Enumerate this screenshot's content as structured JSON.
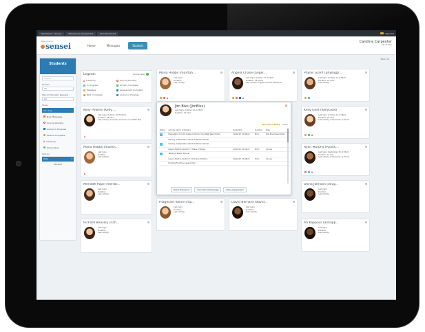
{
  "top_tabs": [
    "Dashboard - Sensei",
    "Attendance Assessment",
    "Plan Document"
  ],
  "top_right": "Sign Out",
  "logo": {
    "small": "Welcome to",
    "main": "sensei"
  },
  "nav": [
    "Home",
    "Messages",
    "Student"
  ],
  "user": {
    "name": "Caroline Carpenter",
    "profile": "My Profile"
  },
  "sidebar": {
    "title": "Students",
    "search_placeholder": "Search",
    "group_label": "Groups",
    "group_value": "All",
    "plan_label": "Plan to Manually Request",
    "plan_value": "All",
    "show_label": "Show",
    "filters": [
      "All / Any",
      "New Messages",
      "Scoring Pending",
      "Locked in Progress",
      "Module Complete",
      "Inactivity",
      "Online Now"
    ],
    "sort_label": "Sort by",
    "sort_value": "Date",
    "sort_option": "Student"
  },
  "total_label": "Total: 20",
  "legend": {
    "title": "Legend:",
    "online_now": "Online Now",
    "items": [
      "Inactivity",
      "Scoring Pending",
      "In Progress",
      "Activity Complete",
      "Message",
      "Assessment Complete",
      "Mod. Complete",
      "Locked in Progress"
    ]
  },
  "students": [
    {
      "name": "Maria Hobbs (maritah...",
      "login": "Last login:",
      "duration": "Duration:",
      "activity": "Last activity:"
    },
    {
      "name": "Angela Chase (angel...",
      "login": "Last login: October 17, 2:35am",
      "duration": "Duration: 14.5mins",
      "activity": "Last activity: Angles and their Measures"
    },
    {
      "name": "Phyllis Grant (phylliggr...",
      "login": "Last login: October 14, 8:46am",
      "duration": "Duration: 16 mins",
      "activity": "Last activity:"
    },
    {
      "name": "Kelly Powers (Kelly ...",
      "login": "Last login: October 13, 8:50 pm",
      "duration": "Duration: 16 mins",
      "activity": "Last activity: Geometry Common Core Math Plan"
    },
    {
      "name": "Kelly Gold (KellyGold)",
      "login": "Last login: October 14, 2:34pm",
      "duration": "Duration: 18 mins",
      "activity": "Last activity: Introduction to Forms"
    },
    {
      "name": "Maria Hobbs (marish...",
      "login": "Last login:",
      "duration": "Duration:",
      "activity": "Last activity:"
    },
    {
      "name": "Ryan Murphy (RyanC...",
      "login": "Last login: September 30, 4:53pm",
      "duration": "Duration: 17 min",
      "activity": "Last activity: Introduction to Forms"
    },
    {
      "name": "Meridith Pope (merdit...",
      "login": "Last login:",
      "duration": "Duration:",
      "activity": "Last activity:"
    },
    {
      "name": "Olivia Johnson (olivg...",
      "login": "Last login:",
      "duration": "Duration:",
      "activity": "Last activity:"
    },
    {
      "name": "Fitzgerald Vance (fitz...",
      "login": "Last login:",
      "duration": "Duration:",
      "activity": "Last activity:"
    },
    {
      "name": "David Bernard (david...",
      "login": "Last login:",
      "duration": "Duration:",
      "activity": "Last activity:"
    },
    {
      "name": "Richard Beasely (rich...",
      "login": "Last login:",
      "duration": "Duration:",
      "activity": "Last activity:"
    },
    {
      "name": "Ari Kappour (arikapp...",
      "login": "Last login:",
      "duration": "Duration:",
      "activity": "Last activity:"
    }
  ],
  "popup": {
    "name": "Jim Bixs (JimBixs)",
    "login": "Last login: October 14, 2:35pm",
    "duration": "Duration: 14.5min",
    "tab_active": "Recent Activity",
    "tab_other": "Users",
    "headers": [
      "Status",
      "Activity (last 5 activities)",
      "Date/Time",
      "Duration",
      "Type"
    ],
    "rows": [
      {
        "activity": "Preparation for 4th Grade Common Core Math Benchmark",
        "date": "10/11/13 12:48pm",
        "duration": "8min",
        "type": "Test Prep Prescription"
      },
      {
        "activity": "Solving multiplication Word Problems Tutorial",
        "date": "",
        "duration": "",
        "type": ""
      },
      {
        "activity": "Solving multiplication Word Problems Tutorial",
        "date": "",
        "duration": "",
        "type": ""
      },
      {
        "activity": "Lesson Math & Section 7: Tables of Ratios",
        "date": "10/11/13 12:42pm",
        "duration": "5min",
        "type": "Course"
      },
      {
        "activity": "Tables of Ratios Tutorial",
        "date": "",
        "duration": "",
        "type": ""
      },
      {
        "activity": "Lesson Math & Section 7: Dividing Fractions",
        "date": "10/11/13 12:38pm",
        "duration": "3min",
        "type": "Course"
      },
      {
        "activity": "Dividing Fractions Lesson Plan",
        "date": "",
        "duration": "",
        "type": ""
      }
    ],
    "actions": [
      "Reset Password",
      "Send Quick Message",
      "New Assignment"
    ]
  },
  "colors": {
    "accent": "#2d7bb3",
    "orange": "#e0882b",
    "alert": "#d9534f"
  }
}
